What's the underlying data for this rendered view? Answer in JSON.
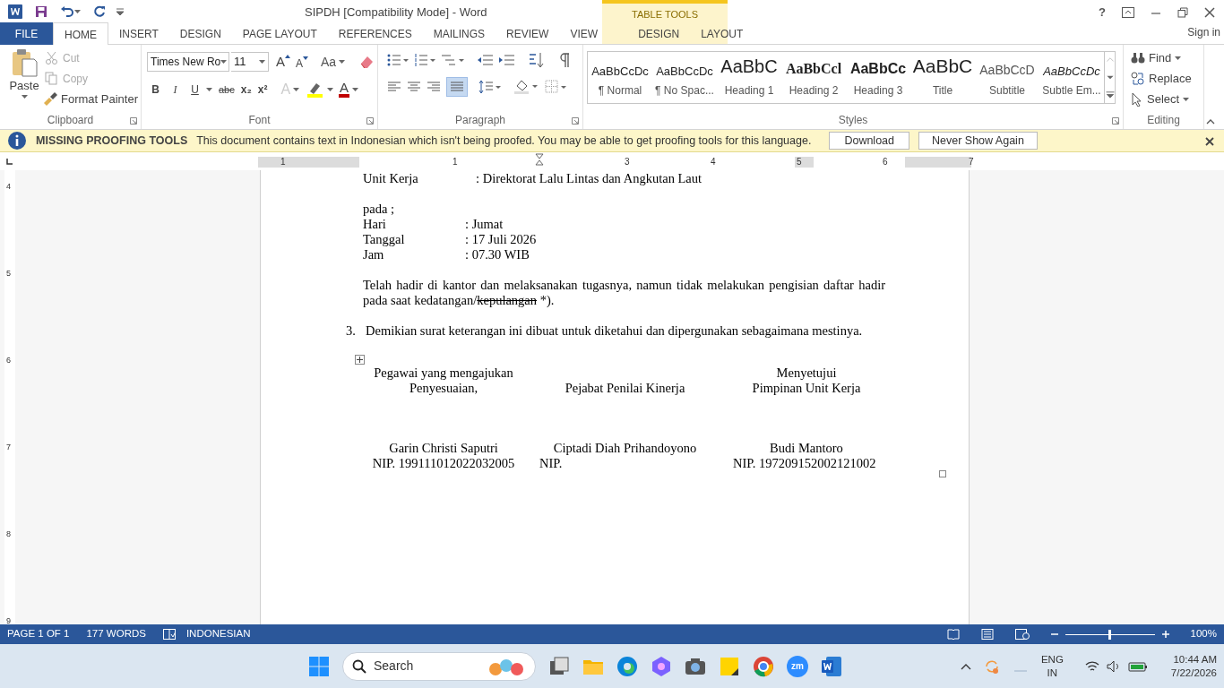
{
  "window": {
    "title": "SIPDH [Compatibility Mode] - Word",
    "contextual_title": "TABLE TOOLS",
    "sign_in": "Sign in",
    "help": "?"
  },
  "tabs": [
    {
      "label": "FILE",
      "kind": "file",
      "selected": false
    },
    {
      "label": "HOME",
      "kind": "normal",
      "selected": true
    },
    {
      "label": "INSERT",
      "kind": "normal",
      "selected": false
    },
    {
      "label": "DESIGN",
      "kind": "normal",
      "selected": false
    },
    {
      "label": "PAGE LAYOUT",
      "kind": "normal",
      "selected": false
    },
    {
      "label": "REFERENCES",
      "kind": "normal",
      "selected": false
    },
    {
      "label": "MAILINGS",
      "kind": "normal",
      "selected": false
    },
    {
      "label": "REVIEW",
      "kind": "normal",
      "selected": false
    },
    {
      "label": "VIEW",
      "kind": "normal",
      "selected": false
    },
    {
      "label": "DESIGN",
      "kind": "contextual",
      "selected": false
    },
    {
      "label": "LAYOUT",
      "kind": "contextual",
      "selected": false
    }
  ],
  "clipboard": {
    "label": "Clipboard",
    "paste": "Paste",
    "cut": {
      "label": "Cut",
      "disabled": true
    },
    "copy": {
      "label": "Copy",
      "disabled": true
    },
    "format_painter": "Format Painter"
  },
  "font": {
    "label": "Font",
    "name": "Times New Ro",
    "size": "11",
    "case": "Aa",
    "bold": "B",
    "italic": "I",
    "underline": "U",
    "strike": "abc",
    "subscript": "x₂",
    "superscript": "x²",
    "grow": "A",
    "shrink": "A",
    "effects": "A",
    "color_letter": "A"
  },
  "paragraph": {
    "label": "Paragraph",
    "justify_selected": true
  },
  "styles": {
    "label": "Styles",
    "items": [
      {
        "preview": "AaBbCcDc",
        "name": "¶ Normal"
      },
      {
        "preview": "AaBbCcDc",
        "name": "¶ No Spac..."
      },
      {
        "preview": "AaBbC",
        "name": "Heading 1"
      },
      {
        "preview": "AaBbCcl",
        "name": "Heading 2"
      },
      {
        "preview": "AaBbCc",
        "name": "Heading 3"
      },
      {
        "preview": "AaBbC",
        "name": "Title"
      },
      {
        "preview": "AaBbCcD",
        "name": "Subtitle"
      },
      {
        "preview": "AaBbCcDc",
        "name": "Subtle Em..."
      }
    ]
  },
  "editing": {
    "label": "Editing",
    "find": "Find",
    "replace": "Replace",
    "select": "Select"
  },
  "message_bar": {
    "title": "MISSING PROOFING TOOLS",
    "text": "This document contains text in Indonesian which isn't being proofed. You may be able to get proofing tools for this language.",
    "buttons": [
      "Download",
      "Never Show Again"
    ]
  },
  "ruler": {
    "horizontal": [
      "1",
      "1",
      "3",
      "4",
      "5",
      "6",
      "7"
    ],
    "vertical": [
      "4",
      "5",
      "6",
      "7",
      "8",
      "9"
    ]
  },
  "document": {
    "unit_row": {
      "label": "Unit Kerja",
      "value": ": Direktorat Lalu Lintas dan Angkutan Laut"
    },
    "pada": "pada ;",
    "fields": [
      {
        "label": "Hari",
        "value": ": Jumat"
      },
      {
        "label": "Tanggal",
        "value": ": 17 Juli 2026"
      },
      {
        "label": "Jam",
        "value": ": 07.30 WIB"
      }
    ],
    "paragraph": {
      "before": "Telah hadir di kantor dan melaksanakan tugasnya, namun tidak melakukan pengisian daftar hadir pada saat kedatangan/",
      "struck": "kepulangan",
      "after": " *)."
    },
    "numbered": {
      "number": "3.",
      "text": "Demikian surat keterangan ini dibuat untuk diketahui dan dipergunakan sebagaimana mestinya."
    },
    "signatures": [
      {
        "title": [
          "Pegawai yang mengajukan",
          "Penyesuaian,"
        ],
        "name": "Garin Christi Saputri",
        "nip": "NIP. 199111012022032005"
      },
      {
        "title": [
          "Pejabat Penilai Kinerja"
        ],
        "name": "Ciptadi Diah Prihandoyono",
        "nip": "NIP."
      },
      {
        "title": [
          "Menyetujui",
          "Pimpinan Unit Kerja"
        ],
        "name": "Budi Mantoro",
        "nip": "NIP. 197209152002121002"
      }
    ]
  },
  "status_bar": {
    "page": "PAGE 1 OF 1",
    "words": "177 WORDS",
    "language": "INDONESIAN",
    "zoom": "100%",
    "zoom_slider": {
      "level": 0.5
    }
  },
  "taskbar": {
    "search": "Search",
    "apps": [
      {
        "kind": "taskview"
      },
      {
        "kind": "folder"
      },
      {
        "kind": "edge"
      },
      {
        "kind": "copilot"
      },
      {
        "kind": "camera"
      },
      {
        "kind": "notes"
      },
      {
        "kind": "chrome"
      },
      {
        "kind": "zoom",
        "label": "zm"
      },
      {
        "kind": "word"
      }
    ],
    "lang": [
      "ENG",
      "IN"
    ],
    "time": "10:44 AM",
    "date": "7/22/2026"
  }
}
